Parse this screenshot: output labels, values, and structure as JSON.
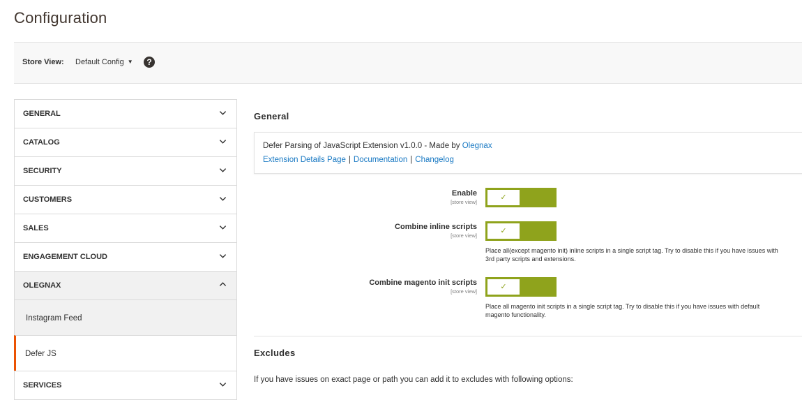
{
  "page": {
    "title": "Configuration"
  },
  "store": {
    "label": "Store View:",
    "value": "Default Config",
    "caret_icon": "caret-down-icon",
    "help_icon": "help-icon",
    "help_glyph": "?"
  },
  "sidebar": {
    "tabs": [
      {
        "label": "GENERAL",
        "expanded": false
      },
      {
        "label": "CATALOG",
        "expanded": false
      },
      {
        "label": "SECURITY",
        "expanded": false
      },
      {
        "label": "CUSTOMERS",
        "expanded": false
      },
      {
        "label": "SALES",
        "expanded": false
      },
      {
        "label": "ENGAGEMENT CLOUD",
        "expanded": false
      },
      {
        "label": "OLEGNAX",
        "expanded": true
      },
      {
        "label": "SERVICES",
        "expanded": false
      }
    ],
    "olegnax_items": [
      {
        "label": "Instagram Feed",
        "current": false
      },
      {
        "label": "Defer JS",
        "current": true
      }
    ]
  },
  "main": {
    "general": {
      "title": "General",
      "info": {
        "text": "Defer Parsing of JavaScript Extension v1.0.0 - Made by",
        "author_link": "Olegnax",
        "links": [
          "Extension Details Page",
          "Documentation",
          "Changelog"
        ],
        "separator": "|"
      },
      "fields": [
        {
          "label": "Enable",
          "scope": "[store view]",
          "enabled": true,
          "note": ""
        },
        {
          "label": "Combine inline scripts",
          "scope": "[store view]",
          "enabled": true,
          "note": "Place all(except magento init) inline scripts in a single script tag. Try to disable this if you have issues with 3rd party scripts and extensions."
        },
        {
          "label": "Combine magento init scripts",
          "scope": "[store view]",
          "enabled": true,
          "note": "Place all magento init scripts in a single script tag. Try to disable this if you have issues with default magento functionality."
        }
      ],
      "check_glyph": "✓",
      "toggle_color": "#8fa31c"
    },
    "excludes": {
      "title": "Excludes",
      "text": "If you have issues on exact page or path you can add it to excludes with following options:"
    }
  },
  "colors": {
    "accent": "#eb5202",
    "link": "#1979c3"
  }
}
